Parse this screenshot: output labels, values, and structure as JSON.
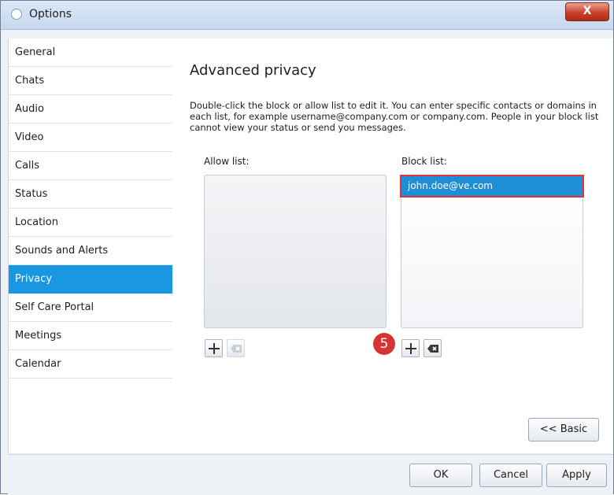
{
  "window": {
    "title": "Options",
    "close_label": "X"
  },
  "sidebar": {
    "items": [
      {
        "label": "General"
      },
      {
        "label": "Chats"
      },
      {
        "label": "Audio"
      },
      {
        "label": "Video"
      },
      {
        "label": "Calls"
      },
      {
        "label": "Status"
      },
      {
        "label": "Location"
      },
      {
        "label": "Sounds and Alerts"
      },
      {
        "label": "Privacy",
        "selected": true
      },
      {
        "label": "Self Care Portal"
      },
      {
        "label": "Meetings"
      },
      {
        "label": "Calendar"
      }
    ]
  },
  "main": {
    "heading": "Advanced privacy",
    "description": "Double-click the block or allow list to edit it. You can enter specific contacts or domains in each list, for example username@company.com or company.com. People in your block list cannot view your status or send you messages.",
    "allow_list": {
      "label": "Allow list:",
      "entries": []
    },
    "block_list": {
      "label": "Block list:",
      "entries": [
        "john.doe@ve.com"
      ]
    },
    "add_icon": "plus-icon",
    "remove_icon": "delete-icon",
    "step_badge": "5",
    "basic_button": "<< Basic"
  },
  "footer": {
    "ok": "OK",
    "cancel": "Cancel",
    "apply": "Apply"
  },
  "colors": {
    "accent": "#1a97e3",
    "selection": "#1e8fd6",
    "highlight_border": "#e5323b",
    "badge": "#d83232"
  }
}
